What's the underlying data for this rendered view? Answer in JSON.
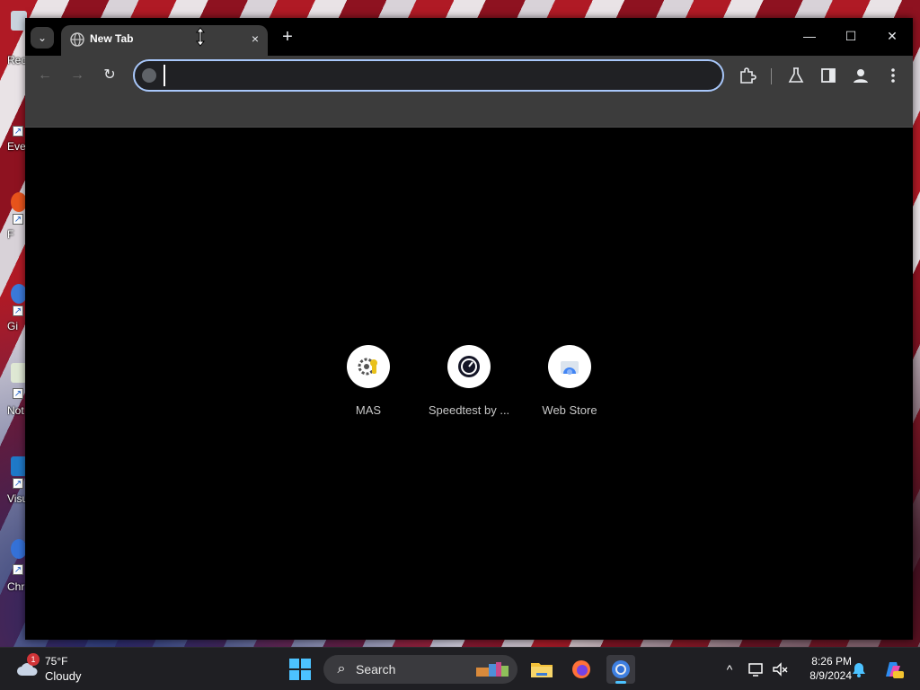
{
  "desktop": {
    "icons": [
      {
        "label": "Rec"
      },
      {
        "label": "Eve"
      },
      {
        "label": "F"
      },
      {
        "label": "Gi"
      },
      {
        "label": "Not"
      },
      {
        "label": "Visu"
      },
      {
        "label": "Chr"
      }
    ]
  },
  "browser": {
    "tab": {
      "title": "New Tab",
      "close_glyph": "×",
      "icon": "globe-icon"
    },
    "tab_search_glyph": "⌄",
    "new_tab_glyph": "+",
    "window_controls": {
      "minimize": "—",
      "maximize": "☐",
      "close": "✕"
    },
    "toolbar": {
      "back_glyph": "←",
      "forward_glyph": "→",
      "reload_glyph": "↻",
      "omnibox_value": "",
      "omnibox_placeholder": ""
    },
    "shortcuts": [
      {
        "label": "MAS",
        "icon": "gear-key-icon"
      },
      {
        "label": "Speedtest by ...",
        "icon": "speedometer-icon"
      },
      {
        "label": "Web Store",
        "icon": "web-store-icon"
      }
    ],
    "colors": {
      "focus_ring": "#a8c7fa",
      "toolbar": "#3c3c3c",
      "frame": "#000000"
    }
  },
  "taskbar": {
    "weather": {
      "badge": "1",
      "temp": "75°F",
      "condition": "Cloudy"
    },
    "search_label": "Search",
    "clock": {
      "time": "8:26 PM",
      "date": "8/9/2024"
    },
    "tray_chevron": "^",
    "accent": "#4cc2ff"
  }
}
